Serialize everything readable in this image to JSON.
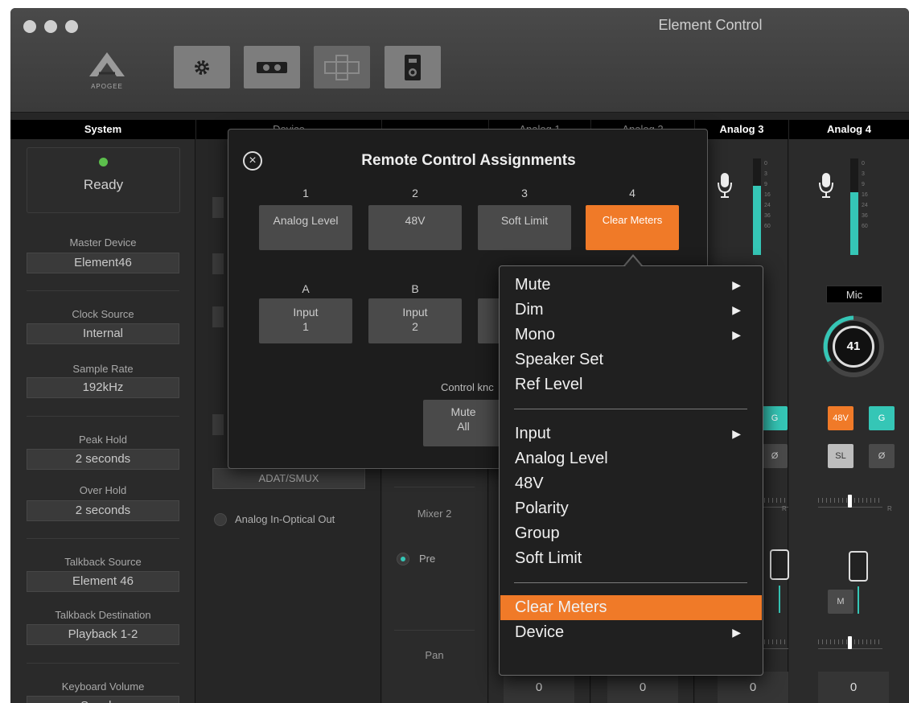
{
  "window": {
    "title": "Element Control",
    "logo_text": "APOGEE"
  },
  "toolbar": {
    "icons": [
      "gear-icon",
      "mixer-icon",
      "routing-icon",
      "remote-icon"
    ]
  },
  "columns": {
    "system": "System",
    "device": "Device",
    "analog1": "Analog 1",
    "analog2": "Analog 2",
    "analog3": "Analog 3",
    "analog4": "Analog 4"
  },
  "system": {
    "status": "Ready",
    "master_device_label": "Master Device",
    "master_device": "Element46",
    "clock_source_label": "Clock Source",
    "clock_source": "Internal",
    "sample_rate_label": "Sample Rate",
    "sample_rate": "192kHz",
    "peak_hold_label": "Peak Hold",
    "peak_hold": "2 seconds",
    "over_hold_label": "Over Hold",
    "over_hold": "2 seconds",
    "talkback_source_label": "Talkback Source",
    "talkback_source": "Element 46",
    "talkback_dest_label": "Talkback Destination",
    "talkback_dest": "Playback 1-2",
    "keyboard_volume_label": "Keyboard Volume",
    "keyboard_volume": "Speaker"
  },
  "device": {
    "optical_mode": "ADAT/SMUX",
    "analog_optical_label": "Analog In-Optical Out"
  },
  "mixer": {
    "mixer2_label": "Mixer 2",
    "pre_label": "Pre",
    "pan_label": "Pan"
  },
  "meter_scale": [
    "0",
    "3",
    "9",
    "16",
    "24",
    "36",
    "60"
  ],
  "analog4": {
    "input_type": "Mic",
    "gain": "41",
    "btn_48v": "48V",
    "btn_g": "G",
    "btn_sl": "SL",
    "btn_polarity": "Ø",
    "btn_m": "M",
    "pan_value": "0",
    "fader_label_r": "R",
    "meter_level": 0.65
  },
  "analog3": {
    "btn_g": "G",
    "btn_polarity": "Ø",
    "pan_value": "0",
    "fader_label_r": "R",
    "meter_level": 0.72
  },
  "pan_values": [
    "0",
    "0"
  ],
  "dialog": {
    "title": "Remote Control Assignments",
    "numbers": [
      "1",
      "2",
      "3",
      "4"
    ],
    "assignments": [
      "Analog Level",
      "48V",
      "Soft Limit",
      "Clear Meters"
    ],
    "letters": [
      "A",
      "B"
    ],
    "letter_assignments": [
      "Input\n1",
      "Input\n2"
    ],
    "control_knob_label": "Control knc",
    "control_knob_value": "Mute\nAll"
  },
  "menu": {
    "items": [
      {
        "label": "Mute",
        "submenu": true
      },
      {
        "label": "Dim",
        "submenu": true
      },
      {
        "label": "Mono",
        "submenu": true
      },
      {
        "label": "Speaker Set",
        "submenu": false
      },
      {
        "label": "Ref Level",
        "submenu": false
      },
      {
        "label": "Input",
        "submenu": true
      },
      {
        "label": "Analog Level",
        "submenu": false
      },
      {
        "label": "48V",
        "submenu": false
      },
      {
        "label": "Polarity",
        "submenu": false
      },
      {
        "label": "Group",
        "submenu": false
      },
      {
        "label": "Soft Limit",
        "submenu": false
      },
      {
        "label": "Clear Meters",
        "submenu": false,
        "highlighted": true
      },
      {
        "label": "Device",
        "submenu": true
      }
    ],
    "submenu_arrow": "▶"
  },
  "colors": {
    "accent": "#f07a28",
    "teal": "#35c6b6",
    "ready_led": "#5cbf4c"
  }
}
